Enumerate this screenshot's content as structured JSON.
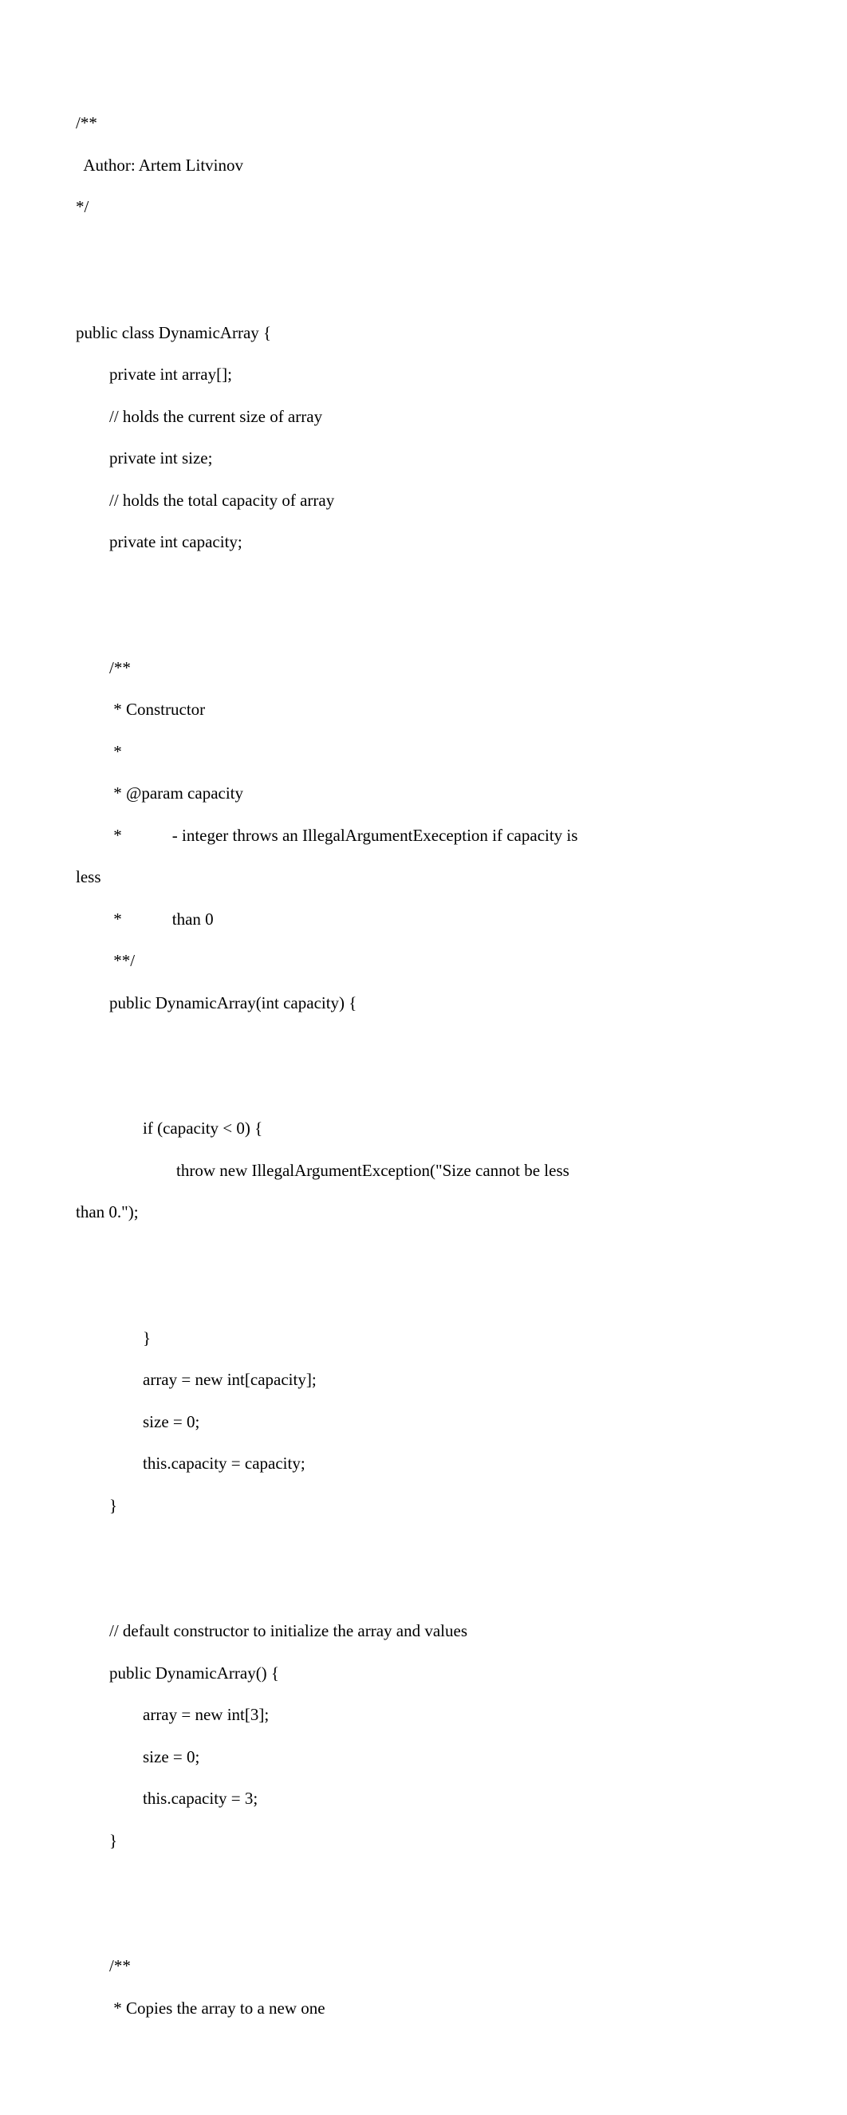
{
  "code": {
    "l01": "/**",
    "l02": "  Author: Artem Litvinov",
    "l03": "*/",
    "l04": "",
    "l05": "",
    "l06": "public class DynamicArray {",
    "l07": "        private int array[];",
    "l08": "        // holds the current size of array",
    "l09": "        private int size;",
    "l10": "        // holds the total capacity of array",
    "l11": "        private int capacity;",
    "l12": "",
    "l13": "",
    "l14": "        /**",
    "l15": "         * Constructor",
    "l16": "         *",
    "l17": "         * @param capacity",
    "l18": "         *            - integer throws an IllegalArgumentExeception if capacity is",
    "l19": "less",
    "l20": "         *            than 0",
    "l21": "         **/",
    "l22": "        public DynamicArray(int capacity) {",
    "l23": "",
    "l24": "",
    "l25": "                if (capacity < 0) {",
    "l26": "                        throw new IllegalArgumentException(\"Size cannot be less",
    "l27": "than 0.\");",
    "l28": "",
    "l29": "",
    "l30": "                }",
    "l31": "                array = new int[capacity];",
    "l32": "                size = 0;",
    "l33": "                this.capacity = capacity;",
    "l34": "        }",
    "l35": "",
    "l36": "",
    "l37": "        // default constructor to initialize the array and values",
    "l38": "        public DynamicArray() {",
    "l39": "                array = new int[3];",
    "l40": "                size = 0;",
    "l41": "                this.capacity = 3;",
    "l42": "        }",
    "l43": "",
    "l44": "",
    "l45": "        /**",
    "l46": "         * Copies the array to a new one"
  }
}
